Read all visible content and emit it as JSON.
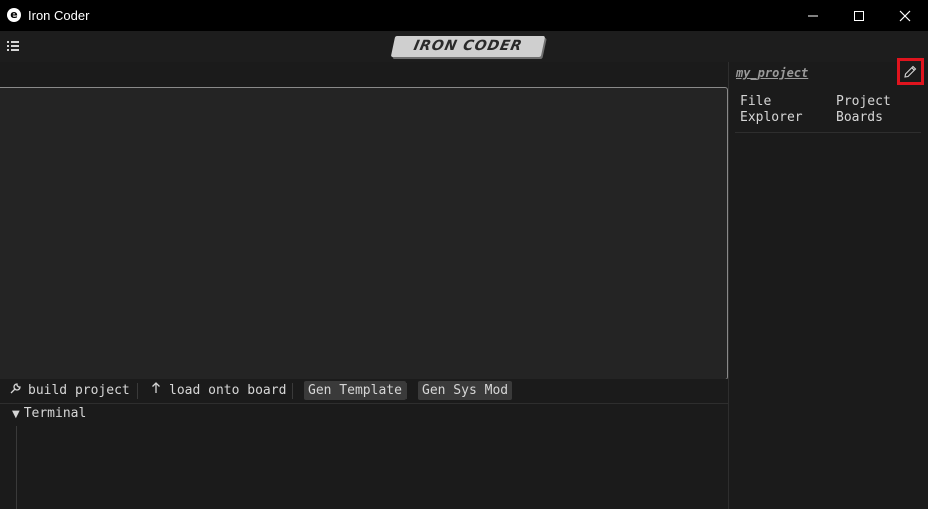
{
  "window": {
    "title": "Iron Coder",
    "app_icon_glyph": "e",
    "controls": [
      "minimize-icon",
      "maximize-icon",
      "close-icon"
    ]
  },
  "menubar": {
    "menu_icon": "list-icon",
    "logo_text": "IRON CODER"
  },
  "toolbar": {
    "build_label": "build project",
    "build_icon": "wrench-icon",
    "load_label": "load onto board",
    "load_icon": "arrow-up-icon",
    "gen_template_label": "Gen Template",
    "gen_sys_mod_label": "Gen Sys Mod"
  },
  "terminal": {
    "label": "Terminal",
    "expanded": true
  },
  "sidebar": {
    "project_name": "my_project",
    "edit_icon": "pencil-icon",
    "tabs": [
      {
        "line1": "File",
        "line2": "Explorer"
      },
      {
        "line1": "Project",
        "line2": "Boards"
      }
    ]
  },
  "colors": {
    "titlebar": "#000000",
    "background": "#1b1b1b",
    "editor": "#242424",
    "highlight": "#e0141e"
  }
}
